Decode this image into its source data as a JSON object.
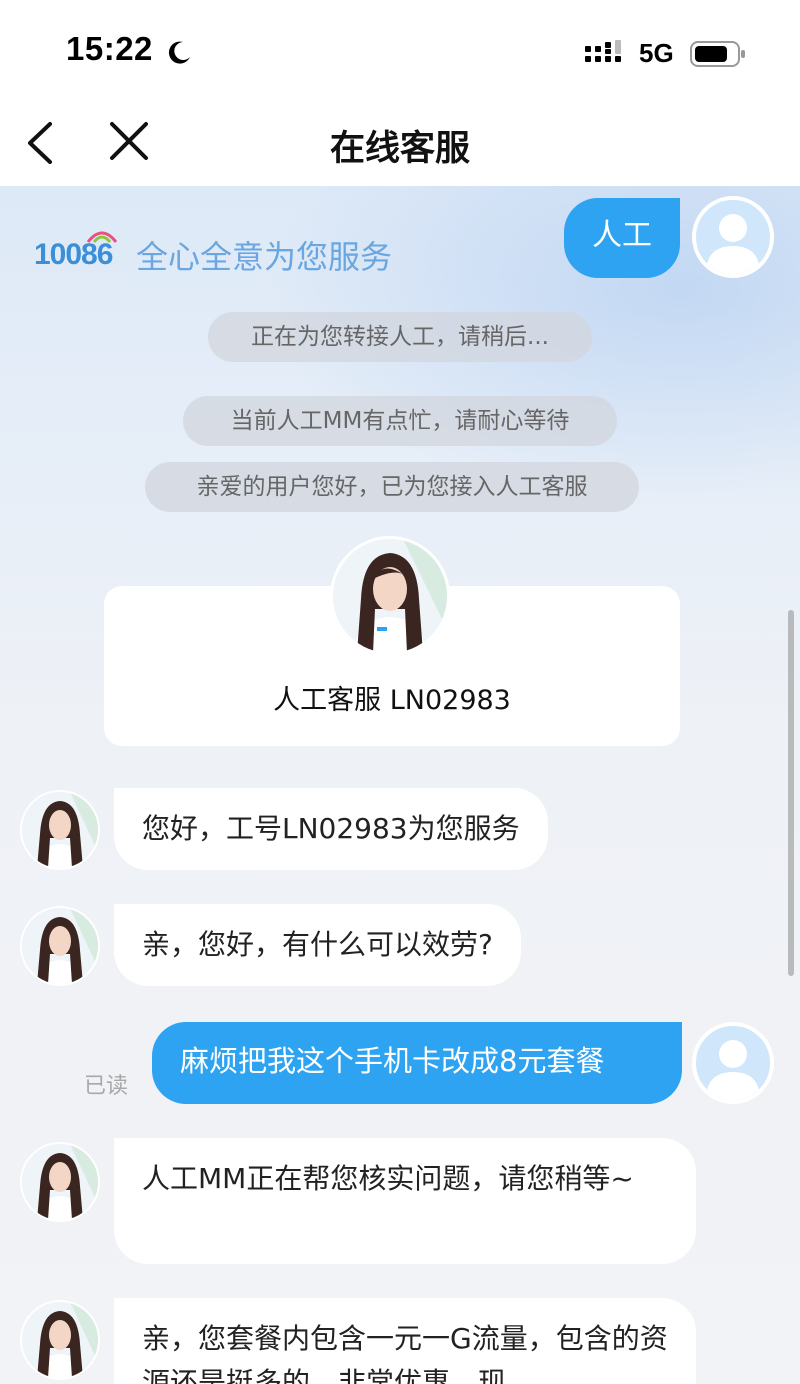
{
  "status_bar": {
    "time": "15:22",
    "network": "5G",
    "icons": [
      "moon-icon",
      "signal-icon",
      "battery-icon"
    ]
  },
  "nav": {
    "title": "在线客服",
    "back_icon": "chevron-left-icon",
    "close_icon": "close-icon"
  },
  "brand": {
    "number": "10086",
    "slogan": "全心全意为您服务"
  },
  "messages": {
    "transfer_button": "人工",
    "system_1": "正在为您转接人工，请稍后...",
    "system_2": "当前人工MM有点忙，请耐心等待",
    "system_3": "亲爱的用户您好，已为您接入人工客服",
    "agent_card_name": "人工客服 LN02983",
    "agent_1": "您好，工号LN02983为您服务",
    "agent_2": "亲，您好，有什么可以效劳?",
    "user_1": "麻烦把我这个手机卡改成8元套餐",
    "read_status": "已读",
    "agent_3": "人工MM正在帮您核实问题，请您稍等~",
    "agent_4": "亲，您套餐内包含一元一G流量，包含的资源还是挺多的，非常优惠，现"
  },
  "colors": {
    "user_bubble": "#2ea3f2",
    "brand_blue": "#3a8fd8",
    "system_pill": "#d2d6de"
  }
}
